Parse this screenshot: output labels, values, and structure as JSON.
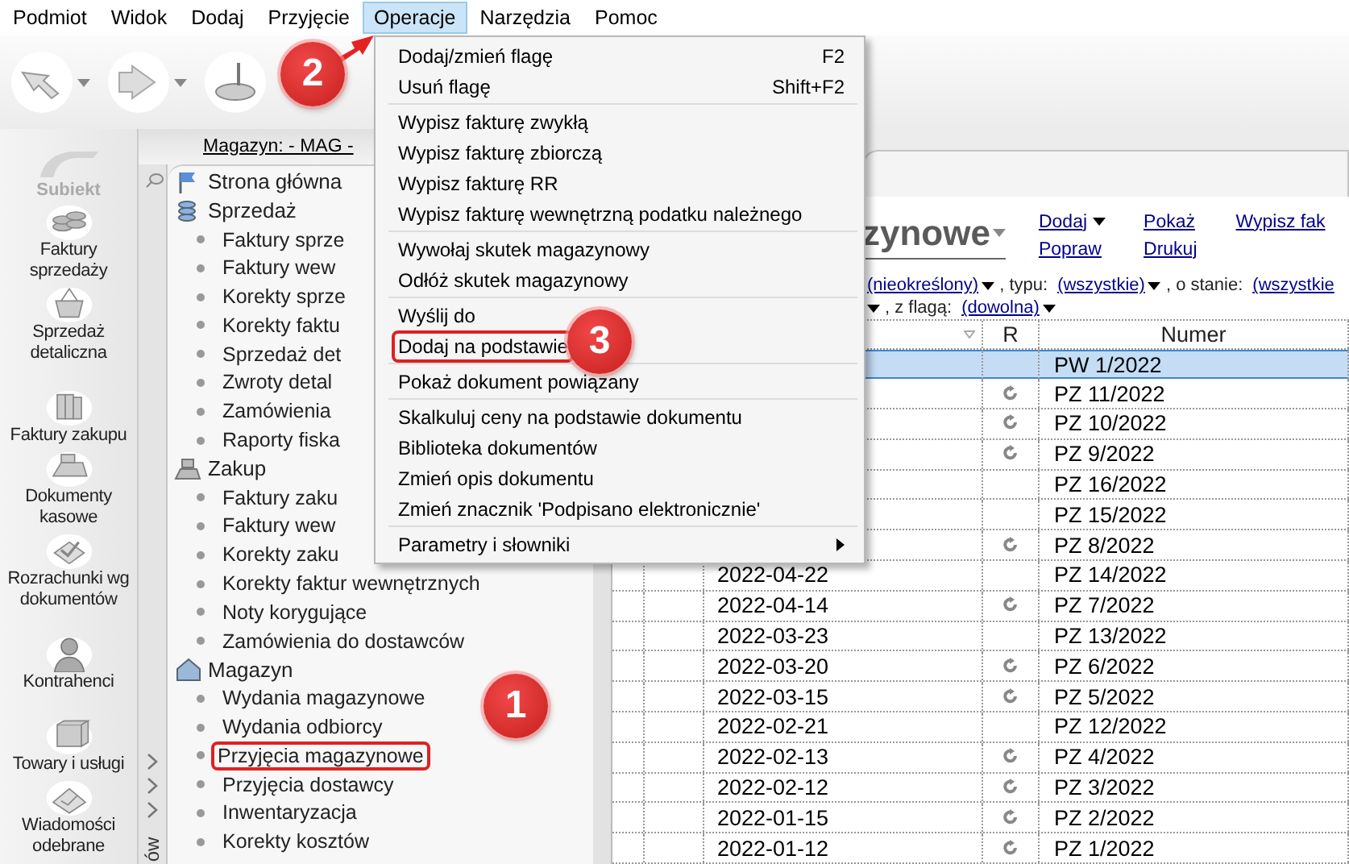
{
  "menu_bar": [
    {
      "label": "Podmiot",
      "selected": false
    },
    {
      "label": "Widok",
      "selected": false
    },
    {
      "label": "Dodaj",
      "selected": false
    },
    {
      "label": "Przyjęcie",
      "selected": false
    },
    {
      "label": "Operacje",
      "selected": true
    },
    {
      "label": "Narzędzia",
      "selected": false
    },
    {
      "label": "Pomoc",
      "selected": false
    }
  ],
  "sidebar": {
    "logo": "Subiekt",
    "items": [
      {
        "label": "Faktury sprzedaży"
      },
      {
        "label": "Sprzedaż detaliczna"
      },
      {
        "label": "Faktury zakupu"
      },
      {
        "label": "Dokumenty kasowe"
      },
      {
        "label": "Rozrachunki wg dokumentów"
      },
      {
        "label": "Kontrahenci"
      },
      {
        "label": "Towary i usługi"
      },
      {
        "label": "Wiadomości odebrane"
      }
    ]
  },
  "side_tab": "ów",
  "breadcrumb": "Magazyn: - MAG -",
  "tree": [
    {
      "label": "Strona główna"
    },
    {
      "label": "Sprzedaż",
      "children": [
        {
          "label": "Faktury sprze",
          "highlighted": false
        },
        {
          "label": "Faktury wew",
          "highlighted": false
        },
        {
          "label": "Korekty sprze",
          "highlighted": false
        },
        {
          "label": "Korekty faktu",
          "highlighted": false
        },
        {
          "label": "Sprzedaż det",
          "highlighted": false
        },
        {
          "label": "Zwroty detal",
          "highlighted": false
        },
        {
          "label": "Zamówienia",
          "highlighted": false
        },
        {
          "label": "Raporty fiska",
          "highlighted": false
        }
      ]
    },
    {
      "label": "Zakup",
      "children": [
        {
          "label": "Faktury zaku",
          "highlighted": false
        },
        {
          "label": "Faktury wew",
          "highlighted": false
        },
        {
          "label": "Korekty zaku",
          "highlighted": false
        },
        {
          "label": "Korekty faktur wewnętrznych",
          "highlighted": false
        },
        {
          "label": "Noty korygujące",
          "highlighted": false
        },
        {
          "label": "Zamówienia do dostawców",
          "highlighted": false
        }
      ]
    },
    {
      "label": "Magazyn",
      "children": [
        {
          "label": "Wydania magazynowe",
          "highlighted": false
        },
        {
          "label": "Wydania odbiorcy",
          "highlighted": false
        },
        {
          "label": "Przyjęcia magazynowe",
          "highlighted": true
        },
        {
          "label": "Przyjęcia dostawcy",
          "highlighted": false
        },
        {
          "label": "Inwentaryzacja",
          "highlighted": false
        },
        {
          "label": "Korekty kosztów",
          "highlighted": false
        }
      ]
    }
  ],
  "document_view": {
    "title": "zynowe",
    "actions": [
      {
        "label": "Dodaj",
        "dropdown": true
      },
      {
        "label": "Popraw",
        "dropdown": false
      },
      {
        "label": "Pokaż",
        "dropdown": false
      },
      {
        "label": "Drukuj",
        "dropdown": false
      },
      {
        "label": "Wypisz fak",
        "dropdown": false
      }
    ],
    "filter_rows": [
      [
        {
          "kind": "link",
          "text": "(nieokreślony)",
          "dropdown": true
        },
        {
          "kind": "label",
          "text": ", typu:"
        },
        {
          "kind": "link",
          "text": "(wszystkie)",
          "dropdown": true
        },
        {
          "kind": "label",
          "text": ", o stanie:"
        },
        {
          "kind": "link",
          "text": "(wszystkie",
          "dropdown": false
        }
      ],
      [
        {
          "kind": "link",
          "dropdown": true
        },
        {
          "kind": "label",
          "text": ", z flagą:"
        },
        {
          "kind": "link",
          "text": "(dowolna)",
          "dropdown": true
        }
      ]
    ],
    "table": {
      "columns": [
        {
          "kind": "blank"
        },
        {
          "kind": "blank"
        },
        {
          "kind": "sortable"
        },
        {
          "kind": "text",
          "label": "R"
        },
        {
          "kind": "text",
          "label": "Numer"
        }
      ],
      "rows": [
        {
          "number": "PW 1/2022",
          "refresh_mark": false,
          "selected": true
        },
        {
          "number": "PZ 11/2022",
          "refresh_mark": true,
          "selected": false
        },
        {
          "number": "PZ 10/2022",
          "refresh_mark": true,
          "selected": false
        },
        {
          "number": "PZ 9/2022",
          "refresh_mark": true,
          "selected": false
        },
        {
          "number": "PZ 16/2022",
          "refresh_mark": false,
          "selected": false
        },
        {
          "number": "PZ 15/2022",
          "refresh_mark": false,
          "selected": false
        },
        {
          "number": "PZ 8/2022",
          "refresh_mark": true,
          "selected": false
        },
        {
          "date": "2022-04-22",
          "number": "PZ 14/2022",
          "refresh_mark": false,
          "selected": false
        },
        {
          "date": "2022-04-14",
          "number": "PZ 7/2022",
          "refresh_mark": true,
          "selected": false
        },
        {
          "date": "2022-03-23",
          "number": "PZ 13/2022",
          "refresh_mark": false,
          "selected": false
        },
        {
          "date": "2022-03-20",
          "number": "PZ 6/2022",
          "refresh_mark": true,
          "selected": false
        },
        {
          "date": "2022-03-15",
          "number": "PZ 5/2022",
          "refresh_mark": true,
          "selected": false
        },
        {
          "date": "2022-02-21",
          "number": "PZ 12/2022",
          "refresh_mark": false,
          "selected": false
        },
        {
          "date": "2022-02-13",
          "number": "PZ 4/2022",
          "refresh_mark": true,
          "selected": false
        },
        {
          "date": "2022-02-12",
          "number": "PZ 3/2022",
          "refresh_mark": true,
          "selected": false
        },
        {
          "date": "2022-01-15",
          "number": "PZ 2/2022",
          "refresh_mark": true,
          "selected": false
        },
        {
          "date": "2022-01-12",
          "number": "PZ 1/2022",
          "refresh_mark": true,
          "selected": false
        }
      ]
    }
  },
  "operations_menu": [
    [
      {
        "label": "Dodaj/zmień flagę",
        "shortcut": "F2",
        "highlighted": false,
        "submenu": false
      },
      {
        "label": "Usuń flagę",
        "shortcut": "Shift+F2",
        "highlighted": false,
        "submenu": false
      }
    ],
    [
      {
        "label": "Wypisz fakturę zwykłą",
        "highlighted": false,
        "submenu": false
      },
      {
        "label": "Wypisz fakturę zbiorczą",
        "highlighted": false,
        "submenu": false
      },
      {
        "label": "Wypisz fakturę RR",
        "highlighted": false,
        "submenu": false
      },
      {
        "label": "Wypisz fakturę wewnętrzną podatku należnego",
        "highlighted": false,
        "submenu": false
      }
    ],
    [
      {
        "label": "Wywołaj skutek magazynowy",
        "highlighted": false,
        "submenu": false
      },
      {
        "label": "Odłóż skutek magazynowy",
        "highlighted": false,
        "submenu": false
      }
    ],
    [
      {
        "label": "Wyślij do",
        "highlighted": false,
        "submenu": false
      },
      {
        "label": "Dodaj na podstawie",
        "highlighted": true,
        "submenu": false
      }
    ],
    [
      {
        "label": "Pokaż dokument powiązany",
        "highlighted": false,
        "submenu": false
      }
    ],
    [
      {
        "label": "Skalkuluj ceny na podstawie dokumentu",
        "highlighted": false,
        "submenu": false
      },
      {
        "label": "Biblioteka dokumentów",
        "highlighted": false,
        "submenu": false
      },
      {
        "label": "Zmień opis dokumentu",
        "highlighted": false,
        "submenu": false
      },
      {
        "label": "Zmień znacznik 'Podpisano elektronicznie'",
        "highlighted": false,
        "submenu": false
      }
    ],
    [
      {
        "label": "Parametry i słowniki",
        "highlighted": false,
        "submenu": true
      }
    ]
  ],
  "annotations": [
    {
      "number": "1",
      "arrow": false
    },
    {
      "number": "2",
      "arrow": true
    },
    {
      "number": "3",
      "arrow": false
    }
  ]
}
